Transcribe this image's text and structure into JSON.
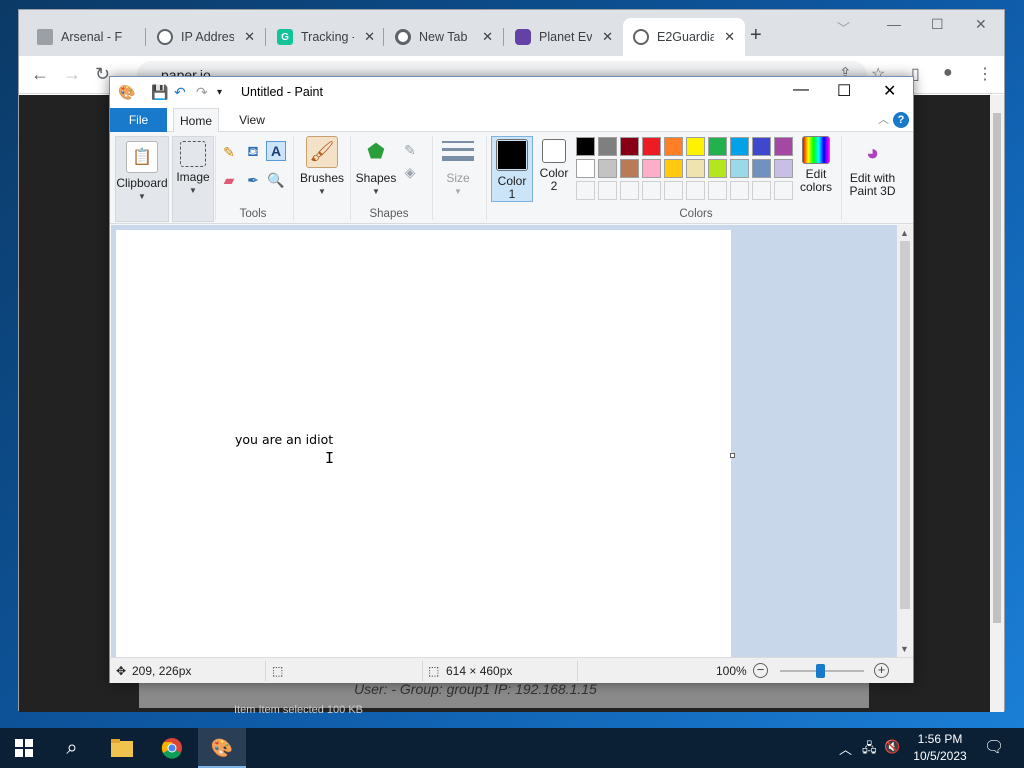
{
  "browser": {
    "tabs": [
      {
        "label": "Arsenal - F",
        "favicon": "document-icon",
        "color": "#9aa0a6"
      },
      {
        "label": "IP Address",
        "favicon": "globe-icon",
        "color": "#5f6368"
      },
      {
        "label": "Tracking -",
        "favicon": "grammarly-icon",
        "color": "#15c39a"
      },
      {
        "label": "New Tab",
        "favicon": "chrome-icon",
        "color": "#5f6368"
      },
      {
        "label": "Planet Eve",
        "favicon": "twitch-icon",
        "color": "#6441a5"
      },
      {
        "label": "E2Guardia",
        "favicon": "globe-icon",
        "color": "#5f6368"
      }
    ],
    "new_tab_symbol": "+",
    "address": "paper.io",
    "page": {
      "user_line": "User: -    Group: group1    IP: 192.168.1.15",
      "items_line": "Item        Item selected  100 KB"
    }
  },
  "paint": {
    "title": "Untitled - Paint",
    "ribbon_tabs": {
      "file": "File",
      "home": "Home",
      "view": "View"
    },
    "clipboard": {
      "label": "Clipboard"
    },
    "image": {
      "label": "Image"
    },
    "tools": {
      "label": "Tools"
    },
    "brushes": {
      "label": "Brushes"
    },
    "shapes": {
      "button_label": "Shapes",
      "group_label": "Shapes"
    },
    "size": {
      "label": "Size"
    },
    "color1": {
      "label_line1": "Color",
      "label_line2": "1",
      "value": "#000000"
    },
    "color2": {
      "label_line1": "Color",
      "label_line2": "2",
      "value": "#ffffff"
    },
    "colors_group_label": "Colors",
    "edit_colors": {
      "line1": "Edit",
      "line2": "colors"
    },
    "edit_paint3d": {
      "line1": "Edit with",
      "line2": "Paint 3D"
    },
    "palette": [
      [
        "#000000",
        "#7f7f7f",
        "#880015",
        "#ed1c24",
        "#ff7f27",
        "#fff200",
        "#22b14c",
        "#00a2e8",
        "#3f48cc",
        "#a349a4"
      ],
      [
        "#ffffff",
        "#c3c3c3",
        "#b97a57",
        "#ffaec9",
        "#ffc90e",
        "#efe4b0",
        "#b5e61d",
        "#99d9ea",
        "#7092be",
        "#c8bfe7"
      ]
    ],
    "canvas_text": "you are an idiot",
    "status": {
      "cursor_pos": "209, 226px",
      "canvas_size": "614 × 460px",
      "zoom": "100%"
    }
  },
  "taskbar": {
    "time": "1:56 PM",
    "date": "10/5/2023"
  }
}
